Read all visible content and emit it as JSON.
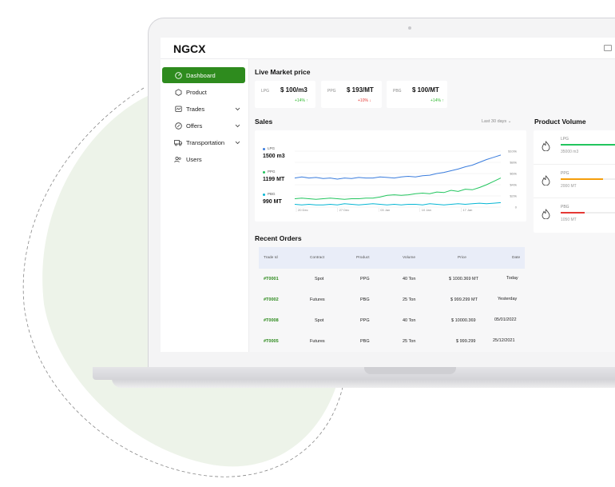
{
  "app": {
    "logo": "NGCX"
  },
  "sidebar": {
    "items": [
      {
        "label": "Dashboard",
        "icon": "dashboard-icon",
        "active": true,
        "has_chevron": false
      },
      {
        "label": "Product",
        "icon": "product-icon",
        "active": false,
        "has_chevron": false
      },
      {
        "label": "Trades",
        "icon": "trades-icon",
        "active": false,
        "has_chevron": true
      },
      {
        "label": "Offers",
        "icon": "offers-icon",
        "active": false,
        "has_chevron": true
      },
      {
        "label": "Transportation",
        "icon": "truck-icon",
        "active": false,
        "has_chevron": true
      },
      {
        "label": "Users",
        "icon": "users-icon",
        "active": false,
        "has_chevron": false
      }
    ]
  },
  "market": {
    "title": "Live Market price",
    "cards": [
      {
        "label": "LPG",
        "price": "$ 100/m3",
        "change": "+14%",
        "direction": "up"
      },
      {
        "label": "PPG",
        "price": "$ 193/MT",
        "change": "+10%",
        "direction": "down"
      },
      {
        "label": "PBG",
        "price": "$ 100/MT",
        "change": "+14%",
        "direction": "up"
      }
    ]
  },
  "sales": {
    "title": "Sales",
    "period": "Last 30 days",
    "legend": [
      {
        "label": "LPG",
        "value": "1500 m3",
        "color": "#3b7ddd"
      },
      {
        "label": "PPG",
        "value": "1199 MT",
        "color": "#22c55e"
      },
      {
        "label": "PBG",
        "value": "990 MT",
        "color": "#06b6d4"
      }
    ]
  },
  "chart_data": {
    "type": "line",
    "x_ticks": [
      "20 Dec",
      "27 Dec",
      "03 Jan",
      "10 Jan",
      "17 Jan"
    ],
    "y_ticks": [
      "$100k",
      "$80k",
      "$60k",
      "$40k",
      "$20k",
      "0"
    ],
    "ylim": [
      0,
      100000
    ],
    "series": [
      {
        "name": "LPG",
        "color": "#3b7ddd",
        "values": [
          52000,
          54000,
          52000,
          53000,
          51000,
          52000,
          50000,
          52000,
          51000,
          53000,
          52000,
          52000,
          54000,
          53000,
          52000,
          54000,
          55000,
          54000,
          56000,
          57000,
          60000,
          62000,
          65000,
          68000,
          72000,
          75000,
          80000,
          85000,
          89000,
          93000
        ]
      },
      {
        "name": "PPG",
        "color": "#22c55e",
        "values": [
          15000,
          16000,
          15000,
          14000,
          15000,
          16000,
          15000,
          14000,
          15000,
          15000,
          16000,
          16000,
          18000,
          21000,
          22000,
          21000,
          22000,
          24000,
          25000,
          24000,
          27000,
          26000,
          30000,
          28000,
          32000,
          31000,
          35000,
          40000,
          46000,
          52000
        ]
      },
      {
        "name": "PBG",
        "color": "#06b6d4",
        "values": [
          5000,
          4000,
          5000,
          4000,
          4000,
          5000,
          4000,
          6000,
          5000,
          4000,
          5000,
          6000,
          5000,
          4000,
          5000,
          4000,
          5000,
          5000,
          4000,
          6000,
          5000,
          4000,
          5000,
          6000,
          5000,
          6000,
          7000,
          6000,
          7000,
          8000
        ]
      }
    ]
  },
  "volume": {
    "title": "Product Volume",
    "items": [
      {
        "label": "LPG",
        "value": "35000 m3",
        "color": "#22c55e",
        "fraction": 0.9
      },
      {
        "label": "PPG",
        "value": "2000 MT",
        "color": "#f59e0b",
        "fraction": 0.7
      },
      {
        "label": "PBG",
        "value": "1050 MT",
        "color": "#e53935",
        "fraction": 0.4
      }
    ]
  },
  "orders": {
    "title": "Recent Orders",
    "columns": [
      "Trade Id",
      "Contract",
      "Product",
      "Volume",
      "Price",
      "Date"
    ],
    "rows": [
      [
        "#T0001",
        "Spot",
        "PPG",
        "40 Ton",
        "$ 1000.369 MT",
        "Today"
      ],
      [
        "#T0002",
        "Futures",
        "PBG",
        "25 Ton",
        "$ 999.299 MT",
        "Yesterday"
      ],
      [
        "#T0008",
        "Spot",
        "PPG",
        "40 Ton",
        "$ 10000.369",
        "05/01/2022"
      ],
      [
        "#T0005",
        "Futures",
        "PBG",
        "25 Ton",
        "$ 999.299",
        "25/12/2021"
      ]
    ]
  }
}
